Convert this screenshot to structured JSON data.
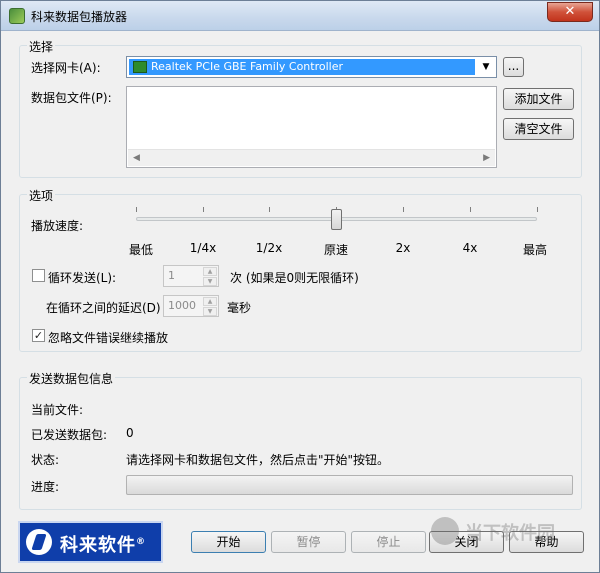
{
  "window": {
    "title": "科来数据包播放器",
    "close_glyph": "✕"
  },
  "select_group": {
    "label": "选择",
    "nic_label": "选择网卡(A):",
    "nic_value": "Realtek PCIe GBE Family Controller",
    "browse_label": "...",
    "file_label": "数据包文件(P):",
    "add_file": "添加文件",
    "clear_file": "清空文件"
  },
  "options_group": {
    "label": "选项",
    "speed_label": "播放速度:",
    "speed_marks": [
      "最低",
      "1/4x",
      "1/2x",
      "原速",
      "2x",
      "4x",
      "最高"
    ],
    "loop_label": "循环发送(L):",
    "loop_checked": false,
    "loop_count": "1",
    "loop_hint": "次 (如果是0则无限循环)",
    "delay_label": "在循环之间的延迟(D)",
    "delay_value": "1000",
    "delay_unit": "毫秒",
    "ignore_label": "忽略文件错误继续播放",
    "ignore_checked": true
  },
  "info_group": {
    "label": "发送数据包信息",
    "current_file_label": "当前文件:",
    "current_file_value": "",
    "sent_label": "已发送数据包:",
    "sent_value": "0",
    "status_label": "状态:",
    "status_value": "请选择网卡和数据包文件，然后点击\"开始\"按钮。",
    "progress_label": "进度:",
    "progress_fraction": 0
  },
  "footer": {
    "logo_text": "科来软件",
    "logo_mark": "®",
    "start": "开始",
    "pause": "暂停",
    "stop": "停止",
    "close": "关闭",
    "help": "帮助",
    "watermark": "当下软件园"
  }
}
